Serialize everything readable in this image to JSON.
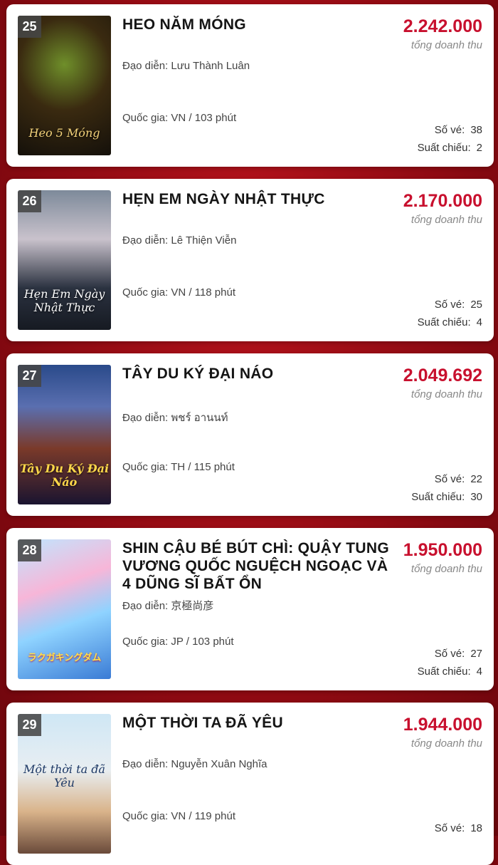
{
  "labels": {
    "gross_caption": "tổng doanh thu",
    "director": "Đạo diễn:",
    "country": "Quốc gia:",
    "tickets": "Số vé:",
    "screenings": "Suất chiếu:"
  },
  "colors": {
    "accent": "#c8102e",
    "background": "#a50f18"
  },
  "movies": [
    {
      "rank": "25",
      "title": "HEO NĂM MÓNG",
      "director": "Lưu Thành Luân",
      "country_runtime": "VN / 103 phút",
      "gross": "2.242.000",
      "tickets": "38",
      "screenings": "2",
      "poster_text": "Heo 5 Móng"
    },
    {
      "rank": "26",
      "title": "HẸN EM NGÀY NHẬT THỰC",
      "director": "Lê Thiện Viễn",
      "country_runtime": "VN / 118 phút",
      "gross": "2.170.000",
      "tickets": "25",
      "screenings": "4",
      "poster_text": "Hẹn Em Ngày Nhật Thực"
    },
    {
      "rank": "27",
      "title": "TÂY DU KÝ ĐẠI NÁO",
      "director": "พชร์ อานนท์",
      "country_runtime": "TH / 115 phút",
      "gross": "2.049.692",
      "tickets": "22",
      "screenings": "30",
      "poster_text": "Tây Du Ký Đại Náo"
    },
    {
      "rank": "28",
      "title": "SHIN CẬU BÉ BÚT CHÌ: QUẬY TUNG VƯƠNG QUỐC NGUỆCH NGOẠC VÀ 4 DŨNG SĨ BẤT ỔN",
      "director": "京極尚彦",
      "country_runtime": "JP / 103 phút",
      "gross": "1.950.000",
      "tickets": "27",
      "screenings": "4",
      "poster_text": "ラクガキングダム"
    },
    {
      "rank": "29",
      "title": "MỘT THỜI TA ĐÃ YÊU",
      "director": "Nguyễn Xuân Nghĩa",
      "country_runtime": "VN / 119 phút",
      "gross": "1.944.000",
      "tickets": "18",
      "screenings": "",
      "poster_text": "Một thời ta đã Yêu"
    }
  ]
}
